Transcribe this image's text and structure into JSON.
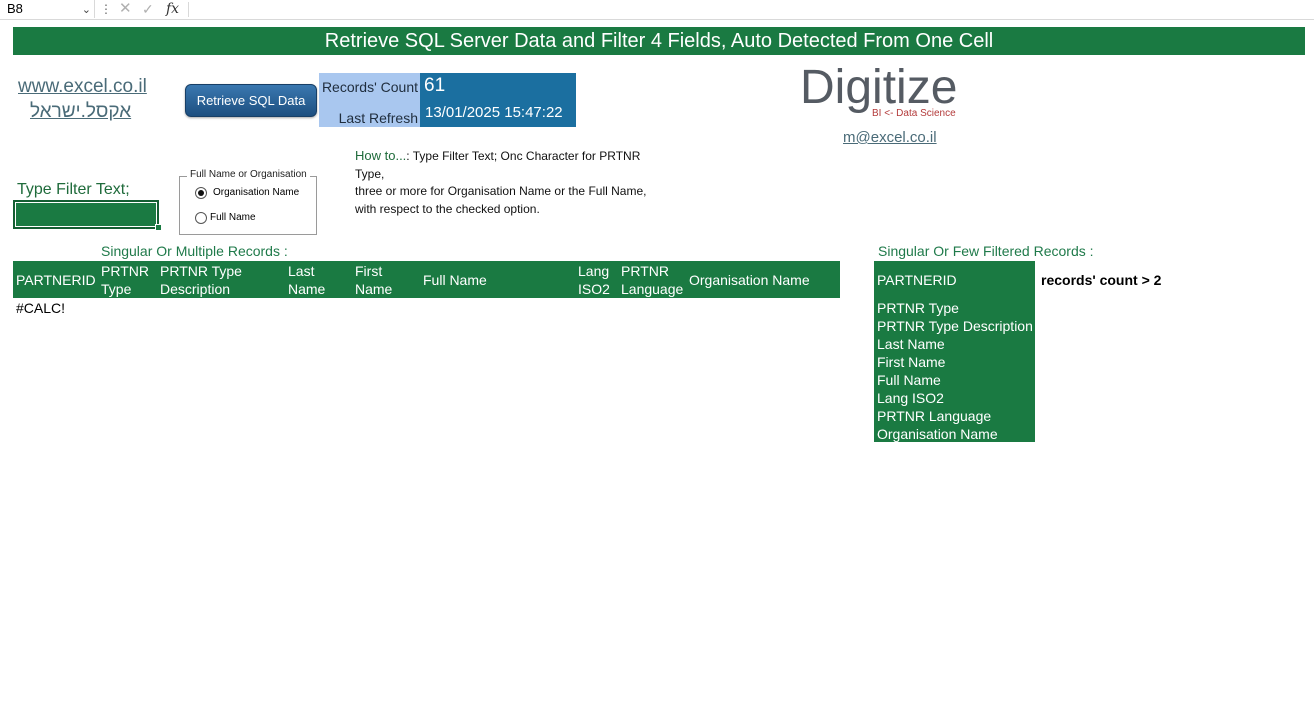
{
  "formula_bar": {
    "cell_ref": "B8",
    "fx_label": "fx",
    "formula": ""
  },
  "title": "Retrieve SQL Server Data and Filter 4 Fields, Auto Detected From One Cell",
  "links": {
    "website": "www.excel.co.il",
    "website_hebrew": "אקסל.ישראל",
    "email": "m@excel.co.il"
  },
  "retrieve_button": "Retrieve SQL Data",
  "status": {
    "count_label": "Records' Count",
    "count_value": "61",
    "refresh_label": "Last Refresh",
    "refresh_value": "13/01/2025 15:47:22"
  },
  "logo": {
    "name": "Digitize",
    "tagline": "BI <- Data Science"
  },
  "filter": {
    "label": "Type Filter Text;",
    "value": ""
  },
  "option_group": {
    "legend": "Full Name or Organisation",
    "options": [
      "Organisation Name",
      "Full Name"
    ],
    "selected": "Organisation Name"
  },
  "howto": {
    "prefix": "How to...",
    "text": ": Type Filter Text; Onc Character for PRTNR Type,\nthree or more for Organisation Name or the Full Name,\nwith respect to the checked option."
  },
  "left_table": {
    "title": "Singular Or Multiple Records :",
    "headers": [
      "PARTNERID",
      "PRTNR Type",
      "PRTNR Type Description",
      "Last Name",
      "First Name",
      "Full Name",
      "Lang ISO2",
      "PRTNR Language",
      "Organisation Name"
    ],
    "error": "#CALC!"
  },
  "right_panel": {
    "title": "Singular Or Few Filtered Records :",
    "fields": [
      "PARTNERID",
      "PRTNR Type",
      "PRTNR Type Description",
      "Last Name",
      "First Name",
      "Full Name",
      "Lang ISO2",
      "PRTNR Language",
      "Organisation Name"
    ],
    "records_note": "records' count >  2"
  },
  "colors": {
    "accent_green": "#1a7a42",
    "label_blue": "#a9c7ef",
    "value_blue": "#1b6fa0",
    "link": "#4a6b78"
  }
}
